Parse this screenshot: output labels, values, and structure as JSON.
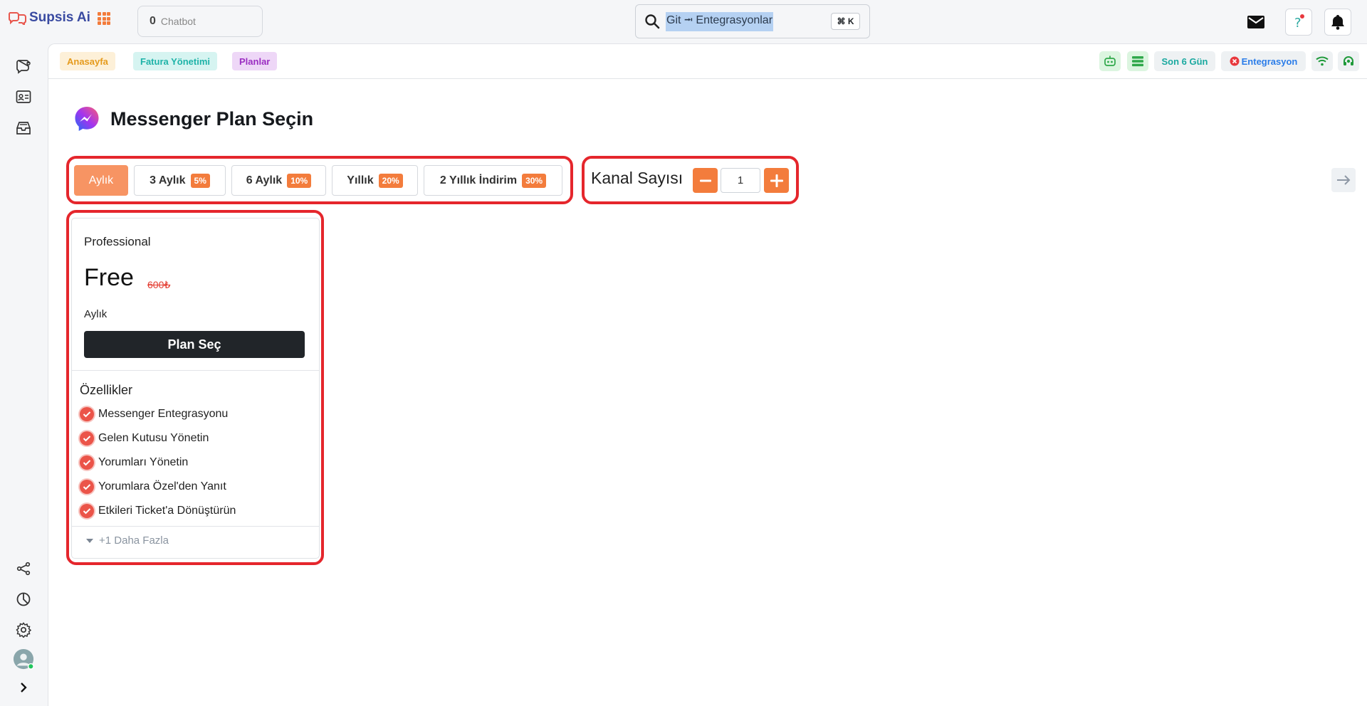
{
  "app": {
    "name": "Supsis Ai"
  },
  "header": {
    "chatbot_count": "0",
    "chatbot_label": "Chatbot",
    "search_text": "Git ⭲ Entegrasyonlar",
    "search_shortcut": "⌘ K"
  },
  "breadcrumbs": [
    "Anasayfa",
    "Fatura Yönetimi",
    "Planlar"
  ],
  "status": {
    "days": "Son 6 Gün",
    "integration": "Entegrasyon"
  },
  "page": {
    "title": "Messenger Plan Seçin"
  },
  "periods": [
    {
      "label": "Aylık",
      "discount": "",
      "active": true
    },
    {
      "label": "3 Aylık",
      "discount": "5%"
    },
    {
      "label": "6 Aylık",
      "discount": "10%"
    },
    {
      "label": "Yıllık",
      "discount": "20%"
    },
    {
      "label": "2 Yıllık İndirim",
      "discount": "30%"
    }
  ],
  "channel": {
    "label": "Kanal Sayısı",
    "value": "1"
  },
  "plan": {
    "name": "Professional",
    "price": "Free",
    "old_price": "600₺",
    "period": "Aylık",
    "select_label": "Plan Seç",
    "features_title": "Özellikler",
    "features": [
      "Messenger Entegrasyonu",
      "Gelen Kutusu Yönetin",
      "Yorumları Yönetin",
      "Yorumlara Özel'den Yanıt",
      "Etkileri Ticket'a Dönüştürün"
    ],
    "more_label": "+1 Daha Fazla"
  },
  "colors": {
    "accent": "#f37c3c",
    "brand": "#394aa1",
    "highlight": "#e5262c"
  }
}
